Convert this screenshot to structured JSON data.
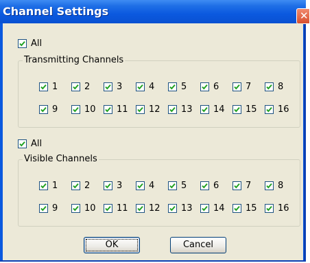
{
  "window": {
    "title": "Channel Settings",
    "close_glyph": "✕"
  },
  "transmitting": {
    "all_label": "All",
    "group_label": "Transmitting Channels",
    "channels": [
      "1",
      "2",
      "3",
      "4",
      "5",
      "6",
      "7",
      "8",
      "9",
      "10",
      "11",
      "12",
      "13",
      "14",
      "15",
      "16"
    ]
  },
  "visible": {
    "all_label": "All",
    "group_label": "Visible Channels",
    "channels": [
      "1",
      "2",
      "3",
      "4",
      "5",
      "6",
      "7",
      "8",
      "9",
      "10",
      "11",
      "12",
      "13",
      "14",
      "15",
      "16"
    ]
  },
  "buttons": {
    "ok": "OK",
    "cancel": "Cancel"
  },
  "state": {
    "all_checked": true,
    "channel_checked": true
  }
}
